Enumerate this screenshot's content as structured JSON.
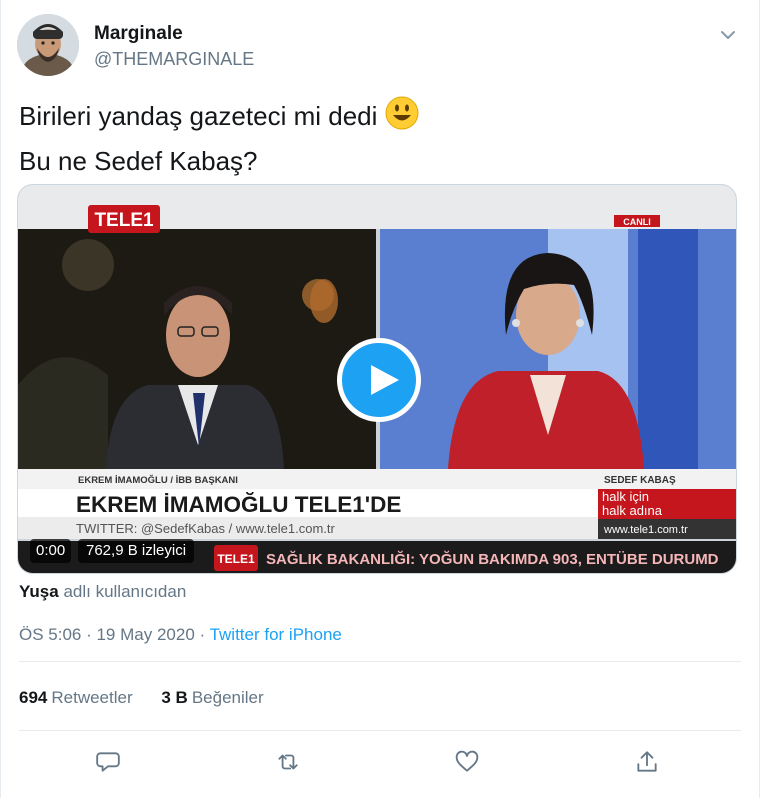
{
  "author": {
    "name": "Marginale",
    "handle": "@THEMARGINALE"
  },
  "tweet": {
    "line1": "Birileri yandaş gazeteci mi dedi",
    "line2": "Bu ne Sedef Kabaş?"
  },
  "video": {
    "time": "0:00",
    "views": "762,9 B izleyici",
    "channel_logo": "TELE1",
    "live_badge": "CANLI",
    "left_name": "EKREM İMAMOĞLU / İBB BAŞKANI",
    "right_name": "SEDEF KABAŞ",
    "headline": "EKREM İMAMOĞLU TELE1'DE",
    "twitter_line": "TWITTER: @SedefKabas / www.tele1.com.tr",
    "slogan_line1": "halk için",
    "slogan_line2": "halk adına",
    "site": "www.tele1.com.tr",
    "ticker_logo": "TELE1",
    "ticker": "SAĞLIK BAKANLIĞI: YOĞUN BAKIMDA 903, ENTÜBE DURUMD"
  },
  "attribution": {
    "user": "Yuşa",
    "suffix": "adlı kullanıcıdan"
  },
  "meta": {
    "timestamp": "ÖS 5:06 · 19 May 2020 · ",
    "source": "Twitter for iPhone"
  },
  "stats": {
    "retweets_count": "694",
    "retweets_label": "Retweetler",
    "likes_count": "3 B",
    "likes_label": "Beğeniler"
  },
  "colors": {
    "accent": "#1da1f2",
    "muted": "#657786",
    "text": "#14171a",
    "tele1_red": "#c4161c"
  },
  "icons": [
    "caret-down-icon",
    "smiley-emoji-icon",
    "play-icon",
    "reply-icon",
    "retweet-icon",
    "like-icon",
    "share-icon"
  ]
}
